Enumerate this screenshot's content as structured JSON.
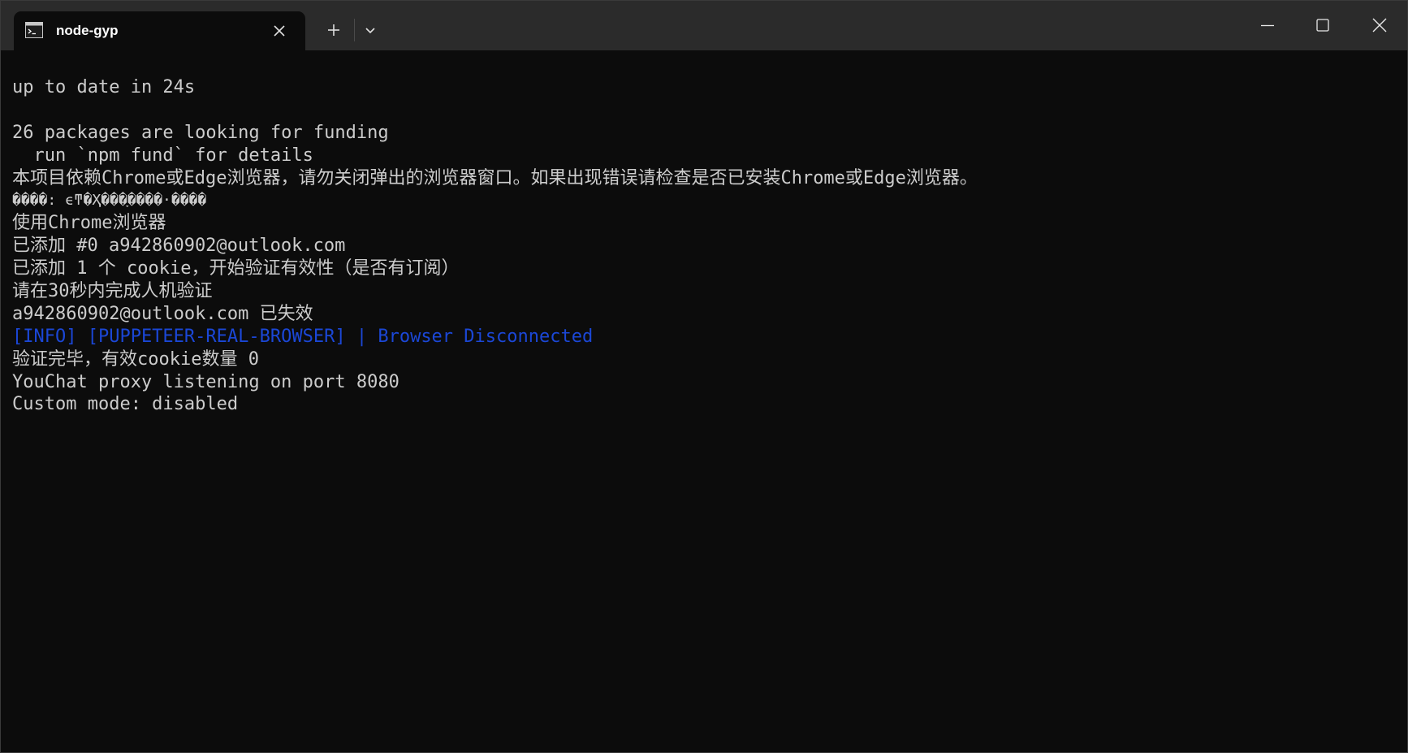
{
  "window": {
    "tab_title": "node-gyp",
    "icons": {
      "tab": "terminal-icon",
      "close_tab": "close-icon",
      "new_tab": "plus-icon",
      "dropdown": "chevron-down-icon",
      "minimize": "minimize-icon",
      "maximize": "maximize-icon",
      "close_window": "close-icon"
    }
  },
  "terminal": {
    "colors": {
      "background": "#0c0c0c",
      "text": "#cccccc",
      "info": "#1b47d6"
    },
    "lines": [
      "up to date in 24s",
      "",
      "26 packages are looking for funding",
      "  run `npm fund` for details",
      "本项目依赖Chrome或Edge浏览器，请勿关闭弹出的浏览器窗口。如果出现错误请检查是否已安装Chrome或Edge浏览器。",
      "����: ϵͳ�Ҳ���ָ����·����",
      "使用Chrome浏览器",
      "已添加 #0 a942860902@outlook.com",
      "已添加 1 个 cookie，开始验证有效性（是否有订阅）",
      "请在30秒内完成人机验证",
      "a942860902@outlook.com 已失效",
      "[INFO] [PUPPETEER-REAL-BROWSER] | Browser Disconnected",
      "验证完毕，有效cookie数量 0",
      "YouChat proxy listening on port 8080",
      "Custom mode: disabled"
    ]
  }
}
